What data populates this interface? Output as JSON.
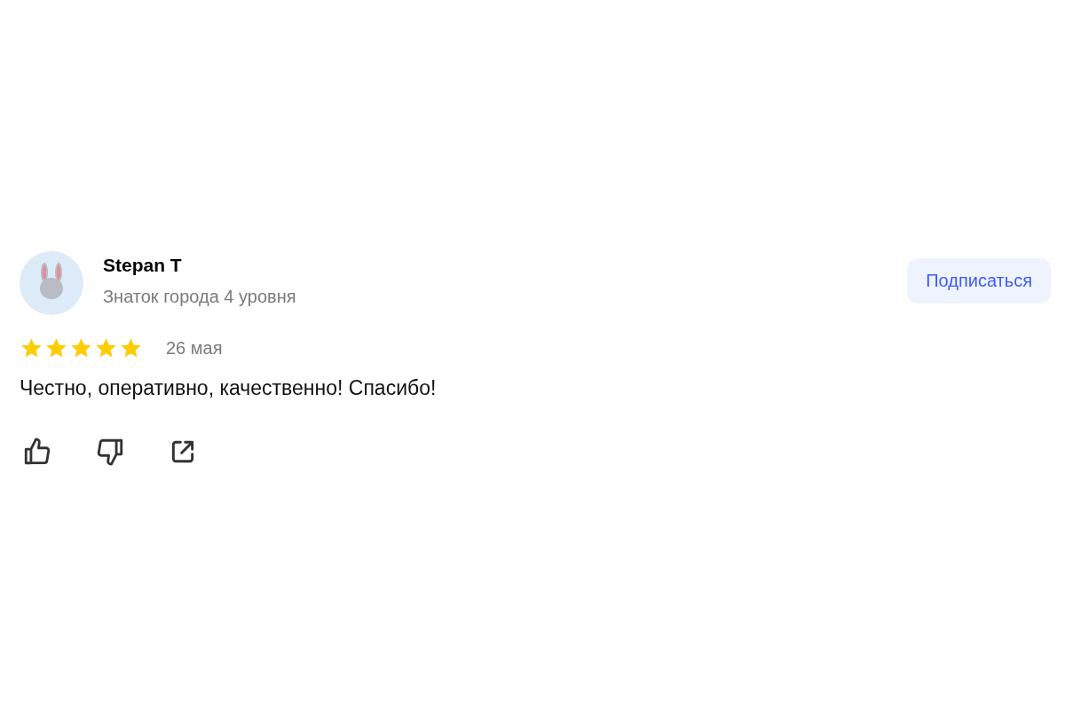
{
  "review": {
    "author": "Stepan T",
    "subtitle": "Знаток города 4 уровня",
    "subscribe_button": "Подписаться",
    "stars": 5,
    "date": "26 мая",
    "text": "Честно, оперативно, качественно! Спасибо!"
  }
}
